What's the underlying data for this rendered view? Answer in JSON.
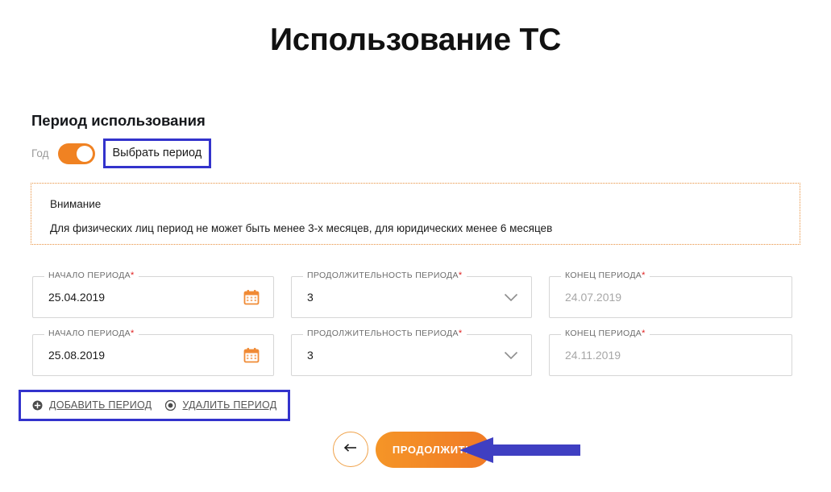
{
  "page": {
    "title": "Использование ТС"
  },
  "section": {
    "heading": "Период использования",
    "toggle": {
      "off_label": "Год",
      "on_label": "Выбрать период",
      "state": "on",
      "track_color": "#f08222",
      "highlight_color": "#3333cc"
    }
  },
  "warning": {
    "title": "Внимание",
    "text": "Для физических лиц период не может быть менее 3-х месяцев, для юридических менее 6 месяцев",
    "border_color": "#e8913f"
  },
  "periods": [
    {
      "start": {
        "label": "НАЧАЛО ПЕРИОДА",
        "required": "*",
        "value": "25.04.2019",
        "icon": "calendar-icon"
      },
      "duration": {
        "label": "ПРОДОЛЖИТЕЛЬНОСТЬ ПЕРИОДА",
        "required": "*",
        "value": "3",
        "icon": "chevron-down-icon"
      },
      "end": {
        "label": "КОНЕЦ ПЕРИОДА",
        "required": "*",
        "value": "24.07.2019"
      }
    },
    {
      "start": {
        "label": "НАЧАЛО ПЕРИОДА",
        "required": "*",
        "value": "25.08.2019",
        "icon": "calendar-icon"
      },
      "duration": {
        "label": "ПРОДОЛЖИТЕЛЬНОСТЬ ПЕРИОДА",
        "required": "*",
        "value": "3",
        "icon": "chevron-down-icon"
      },
      "end": {
        "label": "КОНЕЦ ПЕРИОДА",
        "required": "*",
        "value": "24.11.2019"
      }
    }
  ],
  "links": {
    "add_label": "ДОБАВИТЬ ПЕРИОД",
    "add_icon": "plus-circle-icon",
    "remove_label": "УДАЛИТЬ ПЕРИОД",
    "remove_icon": "minus-circle-icon"
  },
  "footer": {
    "back_icon": "arrow-left-icon",
    "submit_label": "ПРОДОЛЖИТЬ",
    "submit_color": "#f0801f"
  },
  "annotations": {
    "arrow_color": "#3f3fc2"
  }
}
